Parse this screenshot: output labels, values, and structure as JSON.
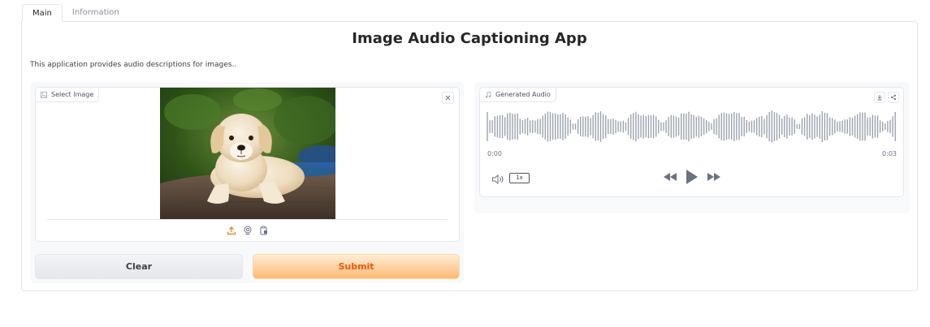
{
  "tabs": [
    {
      "label": "Main",
      "active": true
    },
    {
      "label": "Information",
      "active": false
    }
  ],
  "header": {
    "title": "Image Audio Captioning App",
    "description": "This application provides audio descriptions for images.."
  },
  "image_input": {
    "label": "Select Image",
    "label_icon": "image-icon",
    "close_icon": "close-icon",
    "source_icons": [
      "upload-icon",
      "webcam-icon",
      "clipboard-icon"
    ]
  },
  "buttons": {
    "clear": "Clear",
    "submit": "Submit"
  },
  "audio_output": {
    "label": "Generated Audio",
    "label_icon": "music-note-icon",
    "time_start": "0:00",
    "time_end": "0:03",
    "speed": "1x",
    "action_icons": [
      "download-icon",
      "share-icon"
    ],
    "control_icons": [
      "volume-icon",
      "rewind-icon",
      "play-icon",
      "fast-forward-icon"
    ]
  },
  "colors": {
    "accent": "#f97316",
    "submit_text": "#ea580c",
    "border": "#e5e7eb",
    "waveform": "#9ca3af"
  }
}
